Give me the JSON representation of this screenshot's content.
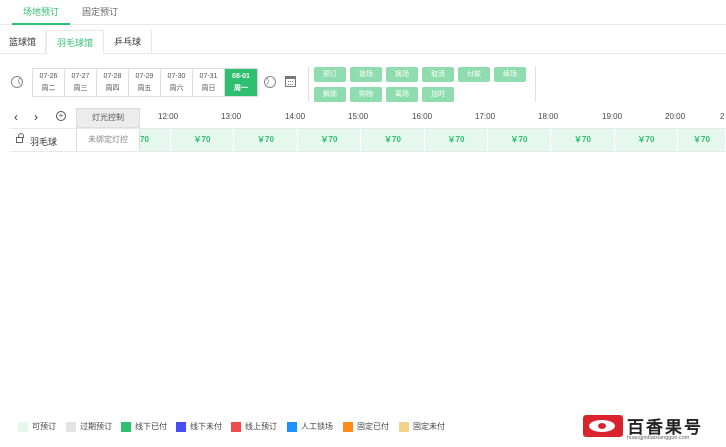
{
  "top_tabs": [
    "场地预订",
    "固定预订"
  ],
  "venue_tabs": [
    "篮球馆",
    "羽毛球馆",
    "乒乓球"
  ],
  "date_nav": {
    "prev_symbol": "〈",
    "next_symbol": "〉"
  },
  "dates": [
    {
      "date": "07-26",
      "weekday": "周二"
    },
    {
      "date": "07-27",
      "weekday": "周三"
    },
    {
      "date": "07-28",
      "weekday": "周四"
    },
    {
      "date": "07-29",
      "weekday": "周五"
    },
    {
      "date": "07-30",
      "weekday": "周六"
    },
    {
      "date": "07-31",
      "weekday": "周日"
    },
    {
      "date": "08-01",
      "weekday": "周一"
    }
  ],
  "selected_date_index": 6,
  "actions": [
    "预订",
    "锁场",
    "换场",
    "取消",
    "付款",
    "续场",
    "解锁",
    "购物",
    "离场",
    "加时"
  ],
  "grid": {
    "light_control_label": "灯光控制",
    "times": [
      "12:00",
      "13:00",
      "14:00",
      "15:00",
      "16:00",
      "17:00",
      "18:00",
      "19:00",
      "20:00",
      "2"
    ]
  },
  "courts": [
    {
      "name": "羽毛球",
      "light_status": "未绑定灯控",
      "first_slot": "70",
      "slots": [
        "￥70",
        "￥70",
        "￥70",
        "￥70",
        "￥70",
        "￥70",
        "￥70",
        "￥70",
        "￥70"
      ]
    }
  ],
  "legend": [
    {
      "label": "可预订",
      "color": "#e6f8ed"
    },
    {
      "label": "过期预订",
      "color": "#e3e3e3"
    },
    {
      "label": "线下已付",
      "color": "#2fbf71"
    },
    {
      "label": "线下未付",
      "color": "#4b4bf5"
    },
    {
      "label": "线上预订",
      "color": "#f04b4b"
    },
    {
      "label": "人工锁场",
      "color": "#1e90ff"
    },
    {
      "label": "固定已付",
      "color": "#ff8c1a"
    },
    {
      "label": "固定未付",
      "color": "#f5d28c"
    }
  ],
  "watermark": {
    "title": "百香果号",
    "subtitle": "huangjinbaixiangguo.com"
  }
}
